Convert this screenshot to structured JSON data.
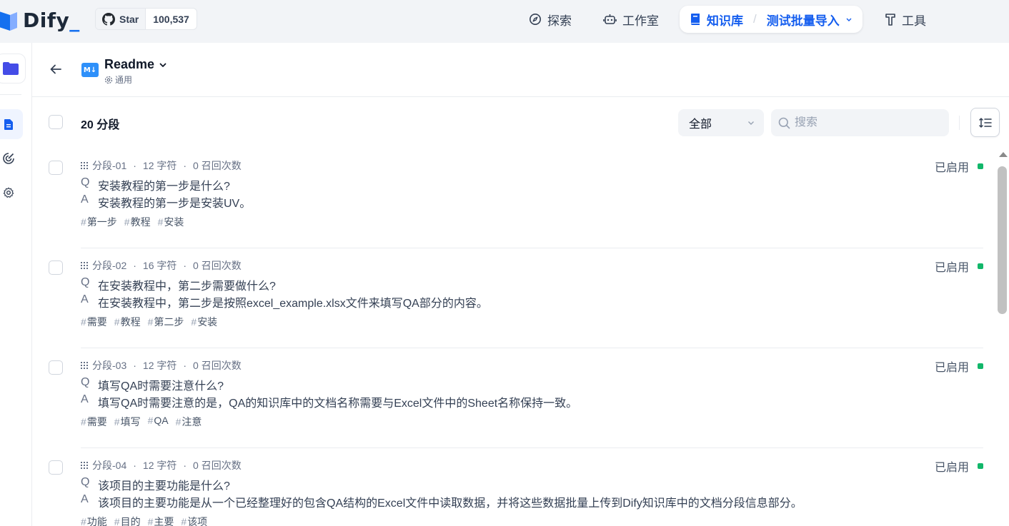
{
  "brand": {
    "name": "Dify",
    "suffix": "_"
  },
  "github": {
    "star_label": "Star",
    "count": "100,537"
  },
  "nav": {
    "explore": "探索",
    "studio": "工作室",
    "knowledge": "知识库",
    "dataset": "测试批量导入",
    "tools": "工具"
  },
  "document": {
    "title": "Readme",
    "mode": "通用"
  },
  "toolbar": {
    "count_label": "20 分段",
    "filter_value": "全部",
    "search_placeholder": "搜索"
  },
  "segments": [
    {
      "id": "分段-01",
      "chars": "12 字符",
      "hits": "0 召回次数",
      "status": "已启用",
      "q_label": "Q",
      "question": "安装教程的第一步是什么?",
      "a_label": "A",
      "answer": "安装教程的第一步是安装UV。",
      "tags": [
        "第一步",
        "教程",
        "安装"
      ]
    },
    {
      "id": "分段-02",
      "chars": "16 字符",
      "hits": "0 召回次数",
      "status": "已启用",
      "q_label": "Q",
      "question": "在安装教程中，第二步需要做什么?",
      "a_label": "A",
      "answer": "在安装教程中，第二步是按照excel_example.xlsx文件来填写QA部分的内容。",
      "tags": [
        "需要",
        "教程",
        "第二步",
        "安装"
      ]
    },
    {
      "id": "分段-03",
      "chars": "12 字符",
      "hits": "0 召回次数",
      "status": "已启用",
      "q_label": "Q",
      "question": "填写QA时需要注意什么?",
      "a_label": "A",
      "answer": "填写QA时需要注意的是，QA的知识库中的文档名称需要与Excel文件中的Sheet名称保持一致。",
      "tags": [
        "需要",
        "填写",
        "QA",
        "注意"
      ]
    },
    {
      "id": "分段-04",
      "chars": "12 字符",
      "hits": "0 召回次数",
      "status": "已启用",
      "q_label": "Q",
      "question": "该项目的主要功能是什么?",
      "a_label": "A",
      "answer": "该项目的主要功能是从一个已经整理好的包含QA结构的Excel文件中读取数据，并将这些数据批量上传到Dify知识库中的文档分段信息部分。",
      "tags": [
        "功能",
        "目的",
        "主要",
        "该项"
      ]
    }
  ],
  "colors": {
    "accent": "#155eef",
    "status_enabled": "#12b76a"
  }
}
